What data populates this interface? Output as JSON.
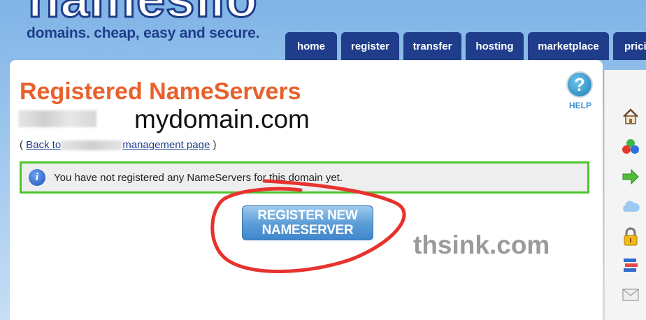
{
  "header": {
    "logo_text": "namesilo",
    "tagline": "domains. cheap, easy and secure."
  },
  "nav": {
    "tabs": [
      {
        "label": "home"
      },
      {
        "label": "register"
      },
      {
        "label": "transfer"
      },
      {
        "label": "hosting"
      },
      {
        "label": "marketplace"
      },
      {
        "label": "pricing"
      }
    ]
  },
  "main": {
    "title": "Registered NameServers",
    "domain": "mydomain.com",
    "back_prefix": "( ",
    "back_link_start": "Back to",
    "back_link_end": "management page",
    "back_suffix": " )",
    "help_label": "HELP",
    "notice_text": "You have not registered any NameServers for this domain yet.",
    "register_button_line1": "REGISTER NEW",
    "register_button_line2": "NAMESERVER",
    "watermark": "thsink.com"
  },
  "sidebar_icons": [
    "home-icon",
    "cubes-icon",
    "arrow-right-icon",
    "cloud-icon",
    "lock-icon",
    "stack-icon",
    "mail-icon"
  ],
  "colors": {
    "brand_blue": "#1f3d8a",
    "title_orange": "#e8602c",
    "notice_border": "#4dc52e",
    "annotation_red": "#e8322d"
  }
}
